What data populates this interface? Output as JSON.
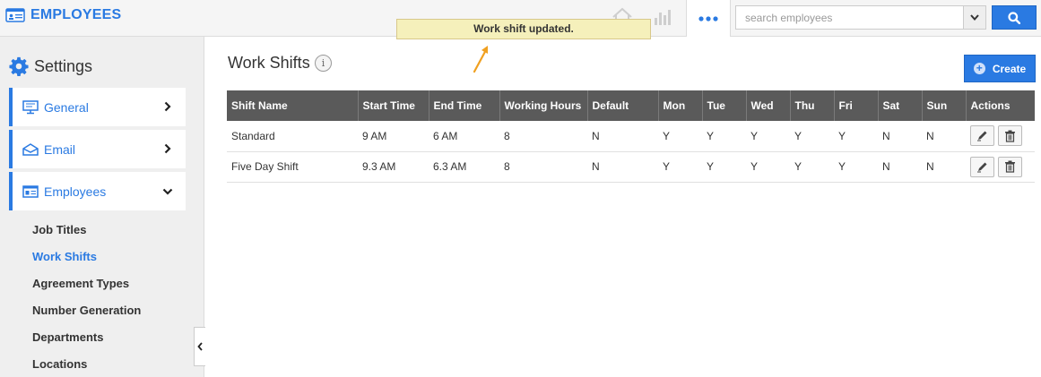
{
  "app": {
    "title": "EMPLOYEES",
    "brand_color": "#2a7ae2",
    "more_icon": "ellipsis-icon"
  },
  "search": {
    "placeholder": "search employees",
    "value": ""
  },
  "toast": {
    "message": "Work shift updated.",
    "background": "#f5f0bb"
  },
  "sidebar": {
    "heading": "Settings",
    "items": [
      {
        "label": "General",
        "icon": "monitor-icon",
        "expanded": false
      },
      {
        "label": "Email",
        "icon": "envelope-icon",
        "expanded": false
      },
      {
        "label": "Employees",
        "icon": "id-card-icon",
        "expanded": true
      }
    ],
    "subitems": [
      {
        "label": "Job Titles",
        "active": false
      },
      {
        "label": "Work Shifts",
        "active": true
      },
      {
        "label": "Agreement Types",
        "active": false
      },
      {
        "label": "Number Generation",
        "active": false
      },
      {
        "label": "Departments",
        "active": false
      },
      {
        "label": "Locations",
        "active": false
      }
    ]
  },
  "main": {
    "title": "Work Shifts",
    "info_glyph": "i",
    "create_label": "Create",
    "columns": [
      "Shift Name",
      "Start Time",
      "End Time",
      "Working Hours",
      "Default",
      "Mon",
      "Tue",
      "Wed",
      "Thu",
      "Fri",
      "Sat",
      "Sun",
      "Actions"
    ],
    "rows": [
      [
        "Standard",
        "9 AM",
        "6 AM",
        "8",
        "N",
        "Y",
        "Y",
        "Y",
        "Y",
        "Y",
        "N",
        "N"
      ],
      [
        "Five Day Shift",
        "9.3 AM",
        "6.3 AM",
        "8",
        "N",
        "Y",
        "Y",
        "Y",
        "Y",
        "Y",
        "N",
        "N"
      ]
    ]
  }
}
